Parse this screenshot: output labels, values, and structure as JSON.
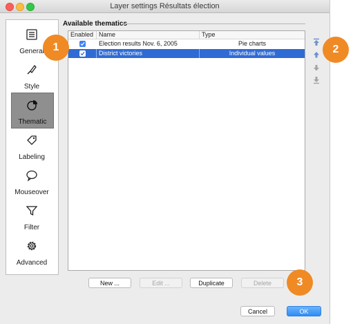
{
  "window": {
    "title": "Layer settings Résultats élection"
  },
  "sidebar": {
    "items": [
      {
        "label": "General",
        "icon": "list-icon"
      },
      {
        "label": "Style",
        "icon": "brush-icon"
      },
      {
        "label": "Thematic",
        "icon": "pie-chart-icon",
        "selected": true
      },
      {
        "label": "Labeling",
        "icon": "tag-icon"
      },
      {
        "label": "Mouseover",
        "icon": "speech-bubble-icon"
      },
      {
        "label": "Filter",
        "icon": "funnel-icon"
      },
      {
        "label": "Advanced",
        "icon": "gear-icon"
      }
    ]
  },
  "main": {
    "section_title": "Available thematics",
    "table": {
      "columns": [
        "Enabled",
        "Name",
        "Type"
      ],
      "rows": [
        {
          "enabled": true,
          "name": "Election results Nov. 6, 2005",
          "type": "Pie charts",
          "selected": false
        },
        {
          "enabled": true,
          "name": "District victories",
          "type": "Individual values",
          "selected": true
        }
      ]
    },
    "side_tools": [
      "move-to-top-icon",
      "move-up-icon",
      "move-down-icon",
      "move-to-bottom-icon"
    ],
    "buttons": {
      "new": "New ...",
      "edit": "Edit ...",
      "duplicate": "Duplicate",
      "delete": "Delete"
    }
  },
  "footer": {
    "cancel": "Cancel",
    "ok": "OK"
  },
  "callouts": [
    "1",
    "2",
    "3"
  ],
  "colors": {
    "accent": "#2f6bd4",
    "callout": "#f08a24",
    "checkbox": "#3b82f7"
  }
}
